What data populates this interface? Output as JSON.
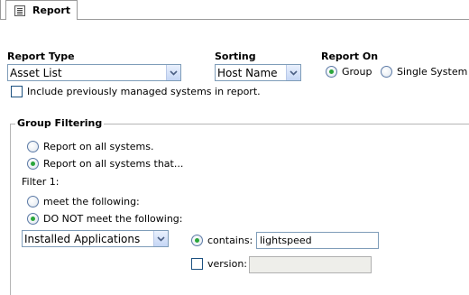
{
  "tab": {
    "label": "Report",
    "icon": "report-icon"
  },
  "report_type": {
    "label": "Report Type",
    "value": "Asset List"
  },
  "sorting": {
    "label": "Sorting",
    "value": "Host Name"
  },
  "report_on": {
    "label": "Report On",
    "options": [
      "Group",
      "Single System"
    ],
    "selected": "Group"
  },
  "include_previous": {
    "label": "Include previously managed systems in report.",
    "checked": false
  },
  "group_filtering": {
    "legend": "Group Filtering",
    "report_all": "Report on all systems.",
    "report_that": "Report on all systems that...",
    "selected_scope": "Report on all systems that...",
    "filter_label": "Filter 1:",
    "meet": "meet the following:",
    "not_meet": "DO NOT meet the following:",
    "selected_meet": "DO NOT meet the following:",
    "field_value": "Installed Applications",
    "contains_label": "contains:",
    "contains_value": "lightspeed",
    "version_label": "version:",
    "version_value": ""
  },
  "colors": {
    "radio_checked": "#2aa63b",
    "input_border": "#7f9db9"
  }
}
